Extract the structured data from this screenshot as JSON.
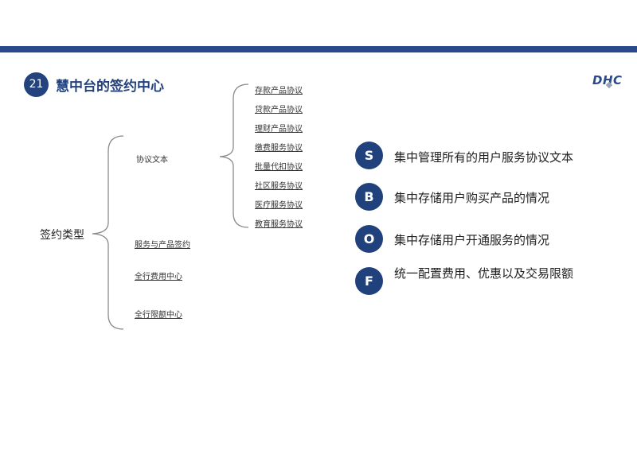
{
  "header": {
    "slide_number": "21",
    "title": "慧中台的签约中心",
    "logo_text": "DHC"
  },
  "tree": {
    "root": "签约类型",
    "branches": [
      "协议文本",
      "服务与产品签约",
      "全行费用中心",
      "全行限额中心"
    ],
    "agreements": [
      "存款产品协议",
      "贷款产品协议",
      "理财产品协议",
      "缴费服务协议",
      "批量代扣协议",
      "社区服务协议",
      "医疗服务协议",
      "教育服务协议"
    ]
  },
  "sbof": [
    {
      "letter": "S",
      "text": "集中管理所有的用户服务协议文本"
    },
    {
      "letter": "B",
      "text": "集中存储用户购买产品的情况"
    },
    {
      "letter": "O",
      "text": "集中存储用户开通服务的情况"
    },
    {
      "letter": "F",
      "text": "统一配置费用、优惠以及交易限额"
    }
  ],
  "colors": {
    "accent": "#23427e",
    "topbar": "#2a4a8b"
  }
}
